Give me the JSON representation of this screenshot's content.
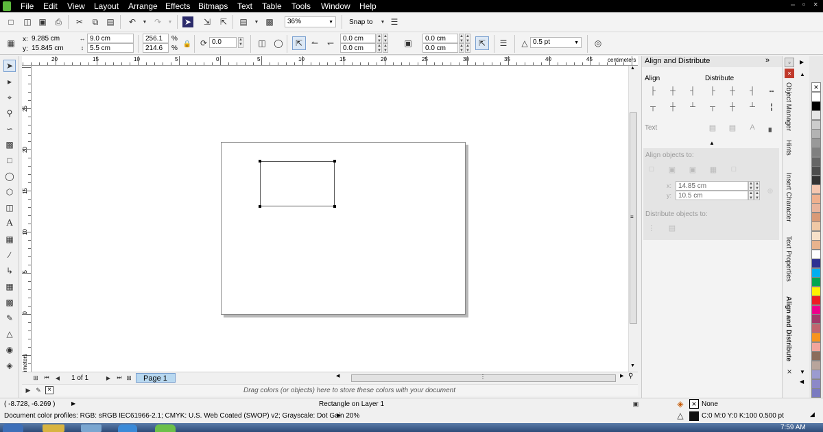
{
  "menubar": {
    "items": [
      "File",
      "Edit",
      "View",
      "Layout",
      "Arrange",
      "Effects",
      "Bitmaps",
      "Text",
      "Table",
      "Tools",
      "Window",
      "Help"
    ],
    "window_controls": [
      "–",
      "▫",
      "×"
    ]
  },
  "std_toolbar": {
    "zoom": "36%",
    "snap_to": "Snap to"
  },
  "prop_toolbar": {
    "x_label": "x:",
    "x_value": "9.285 cm",
    "y_label": "y:",
    "y_value": "15.845 cm",
    "w_value": "9.0 cm",
    "h_value": "5.5 cm",
    "scale_w": "256.1",
    "scale_h": "214.6",
    "pct": "%",
    "rotation": "0.0",
    "corner_1": "0.0 cm",
    "corner_2": "0.0 cm",
    "corner_3": "0.0 cm",
    "corner_4": "0.0 cm",
    "outline": "0.5 pt"
  },
  "ruler": {
    "units": "centimeters",
    "h_ticks": [
      "20",
      "15",
      "10",
      "5",
      "0",
      "5",
      "10",
      "15",
      "20",
      "25",
      "30",
      "35",
      "40",
      "45"
    ],
    "v_ticks": [
      "25",
      "20",
      "15",
      "10",
      "5",
      "0"
    ],
    "v_units": "centimeters"
  },
  "page_nav": {
    "page_count": "1 of 1",
    "page_tab": "Page 1"
  },
  "palette_well": {
    "hint": "Drag colors (or objects) here to store these colors with your document"
  },
  "docker": {
    "title": "Align and Distribute",
    "align": "Align",
    "distribute": "Distribute",
    "text": "Text",
    "align_objects_to": "Align objects to:",
    "x_label": "x:",
    "x_value": "14.85 cm",
    "y_label": "y:",
    "y_value": "10.5 cm",
    "distribute_objects_to": "Distribute objects to:"
  },
  "vtabs": [
    "Object Manager",
    "Hints",
    "Insert Character",
    "Text Properties",
    "Align and Distribute"
  ],
  "palette_colors": [
    "#ffffff",
    "#000000",
    "#e6e6e6",
    "#cccccc",
    "#b3b3b3",
    "#999999",
    "#808080",
    "#666666",
    "#4d4d4d",
    "#333333",
    "#f5c7b0",
    "#efb08e",
    "#e9b49c",
    "#d99a77",
    "#f0c8a5",
    "#f7e1c9",
    "#e8b38d",
    "#ffffff",
    "#2e3192",
    "#00aeef",
    "#00a651",
    "#fff200",
    "#ed1c24",
    "#ec008c",
    "#a3396b",
    "#c1656f",
    "#f7941d",
    "#f2a59c",
    "#8b6d5c",
    "#b8a59c",
    "#9b9bd0",
    "#8c88c8",
    "#7b7bc0",
    "#5f5fa8",
    "#a0a0d8",
    "#b4b4e0"
  ],
  "status": {
    "coords": "( -8.728, -6.269 )",
    "object_info": "Rectangle on Layer 1",
    "fill": "None",
    "outline_info": "C:0 M:0 Y:0 K:100  0.500 pt",
    "color_profiles": "Document color profiles: RGB: sRGB IEC61966-2.1; CMYK: U.S. Web Coated (SWOP) v2; Grayscale: Dot Gain 20%",
    "clock": "7:59 AM"
  }
}
